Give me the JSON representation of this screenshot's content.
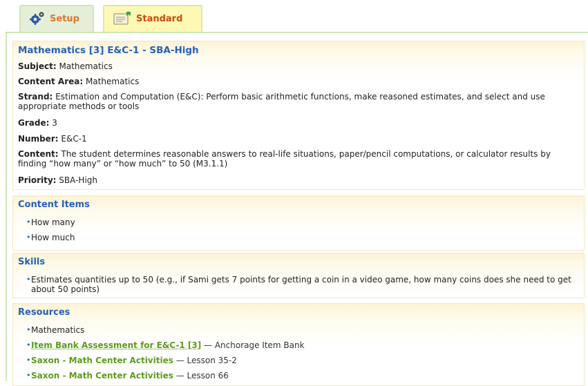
{
  "tabs": [
    {
      "label": "Setup"
    },
    {
      "label": "Standard"
    }
  ],
  "standard": {
    "title": "Mathematics [3] E&C-1 - SBA-High",
    "fields": [
      {
        "label": "Subject:",
        "value": "Mathematics"
      },
      {
        "label": "Content Area:",
        "value": "Mathematics"
      },
      {
        "label": "Strand:",
        "value": "Estimation and Computation (E&C): Perform basic arithmetic functions, make reasoned estimates, and select and use appropriate methods or tools"
      },
      {
        "label": "Grade:",
        "value": "3"
      },
      {
        "label": "Number:",
        "value": "E&C-1"
      },
      {
        "label": "Content:",
        "value": "The student determines reasonable answers to real-life situations, paper/pencil computations, or calculator results by finding “how many” or “how much” to 50 (M3.1.1)"
      },
      {
        "label": "Priority:",
        "value": "SBA-High"
      }
    ]
  },
  "content_items": {
    "title": "Content Items",
    "items": [
      "How many",
      "How much"
    ]
  },
  "skills": {
    "title": "Skills",
    "items": [
      "Estimates quantities up to 50 (e.g., if Sami gets 7 points for getting a coin in a video game, how many coins does she need to get about 50 points)"
    ]
  },
  "resources": {
    "title": "Resources",
    "items": [
      {
        "text": "Mathematics"
      },
      {
        "link": "Item Bank Assessment for E&C-1 [3]",
        "suffix": " — Anchorage Item Bank"
      },
      {
        "link": "Saxon - Math Center Activities",
        "suffix": " — Lesson 35-2"
      },
      {
        "link": "Saxon - Math Center Activities",
        "suffix": " — Lesson 66"
      }
    ]
  }
}
